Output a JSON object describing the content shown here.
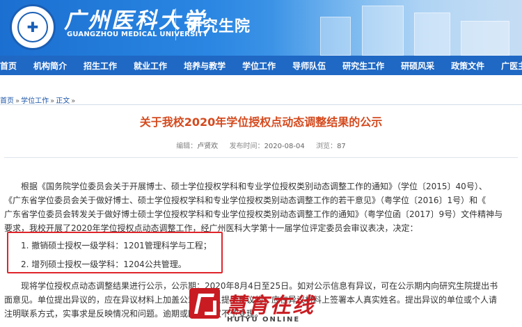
{
  "header": {
    "logo_text": "广州医科大学",
    "university_name": "广州医科大学",
    "university_name_en": "GUANGZHOU MEDICAL UNIVERSITY",
    "site_name": "研究生院",
    "brand_color": "#1f68c4"
  },
  "nav": {
    "items": [
      "首页",
      "机构简介",
      "招生工作",
      "就业工作",
      "培养与教学",
      "学位工作",
      "导师队伍",
      "研究生工作",
      "研硕风采",
      "政策文件",
      "广医主页"
    ]
  },
  "breadcrumb": {
    "home": "首页",
    "section": "学位工作",
    "current": "正文",
    "separator": "»"
  },
  "article": {
    "title": "关于我校2020年学位授权点动态调整结果的公示",
    "editor_label": "编辑：",
    "editor": "卢贤欢",
    "date_label": "发布时间：",
    "date": "2020-08-04",
    "views_label": "浏览：",
    "views": "87",
    "title_color": "#d44a1e",
    "paragraph1": [
      "根据《国务院学位委员会关于开展博士、硕士学位授权学科和专业学位授权类别动态调整工作的通知》（学位〔2015〕40号）、",
      "《广东省学位委员会关于做好博士、硕士学位授权学科和专业学位授权类别动态调整工作的若干意见》（粤学位〔2016〕1号）和《",
      "广东省学位委员会转发关于做好博士硕士学位授权学科和专业学位授权类别动态调整工作的通知》（粤学位函〔2017〕9号）文件精神与",
      "要求，我校开展了2020年学位授权点动态调整工作，经广州医科大学第十一届学位评定委员会审议表决，决定："
    ],
    "decision_items": [
      "1. 撤销硕士授权一级学科：1201管理科学与工程；",
      "2. 增列硕士授权一级学科：1204公共管理。"
    ],
    "highlight_color": "#e0242a",
    "paragraph2": [
      "现将学位授权点动态调整结果进行公示，公示期：2020年8月4日至25日。如对公示信息有异议，可在公示期内向研究生院提出书",
      "面意见。单位提出异议的，应在异议材料上加盖公章；个人提出异议的，应在异议材料上签署本人真实姓名。提出异议的单位或个人请",
      "注明联系方式，实事求是反映情况和问题。逾期或匿名异议不予受理。"
    ]
  },
  "watermark": {
    "name_cn": "慧育在线",
    "name_en": "HUIYU ONLINE",
    "color": "#c81c22"
  }
}
